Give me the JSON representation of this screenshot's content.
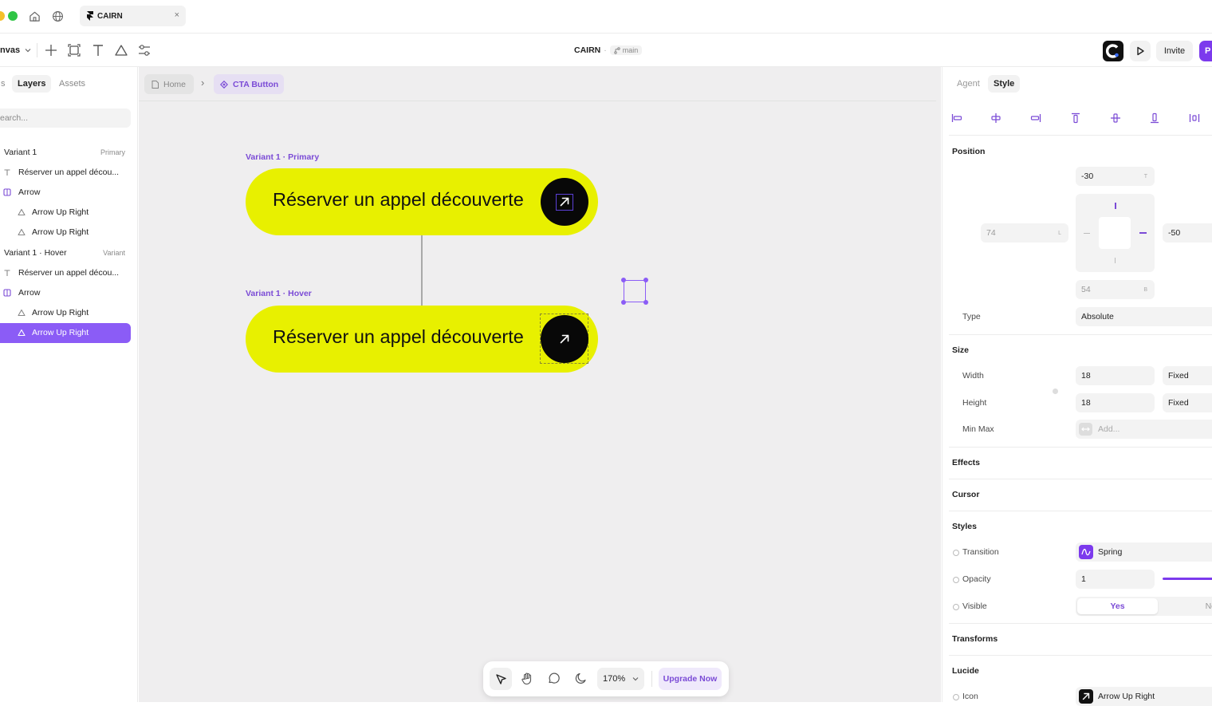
{
  "titlebar": {
    "tab_title": "CAIRN",
    "tab_close": "×"
  },
  "toolbar": {
    "mode_label": "nvas",
    "project_name": "CAIRN",
    "separator": "·",
    "branch": "main",
    "invite_label": "Invite",
    "publish_label": "P"
  },
  "left_panel": {
    "tab_cut": "s",
    "tabs": [
      "Layers",
      "Assets"
    ],
    "search_placeholder": "earch...",
    "layers": [
      {
        "label": "Variant 1",
        "sub": "Primary",
        "kind": "group",
        "selected": false
      },
      {
        "label": "Réserver un appel décou...",
        "kind": "text",
        "selected": false
      },
      {
        "label": "Arrow",
        "kind": "component",
        "selected": false
      },
      {
        "label": "Arrow Up Right",
        "kind": "vector",
        "selected": false
      },
      {
        "label": "Arrow Up Right",
        "kind": "vector",
        "selected": false
      },
      {
        "label": "Variant 1 · Hover",
        "sub": "Variant",
        "kind": "group",
        "selected": false
      },
      {
        "label": "Réserver un appel décou...",
        "kind": "text",
        "selected": false
      },
      {
        "label": "Arrow",
        "kind": "component",
        "selected": false
      },
      {
        "label": "Arrow Up Right",
        "kind": "vector",
        "selected": false
      },
      {
        "label": "Arrow Up Right",
        "kind": "vector",
        "selected": true
      }
    ]
  },
  "canvas": {
    "breadcrumbs": [
      "Home",
      "CTA Button"
    ],
    "breadcrumb_sep": "›",
    "variant_primary_label": "Variant 1 · Primary",
    "variant_hover_label": "Variant 1 · Hover",
    "cta_text": "Réserver un appel découverte"
  },
  "bottom_bar": {
    "zoom": "170%",
    "upgrade_label": "Upgrade Now"
  },
  "right_panel": {
    "tabs": [
      "Agent",
      "Style"
    ],
    "position": {
      "title": "Position",
      "top": "-30",
      "top_unit": "T",
      "left": "74",
      "left_unit": "L",
      "right": "-50",
      "bottom": "54",
      "bottom_unit": "B",
      "type_label": "Type",
      "type_value": "Absolute"
    },
    "size": {
      "title": "Size",
      "width_label": "Width",
      "width_value": "18",
      "width_mode": "Fixed",
      "height_label": "Height",
      "height_value": "18",
      "height_mode": "Fixed",
      "minmax_label": "Min Max",
      "minmax_placeholder": "Add..."
    },
    "effects_title": "Effects",
    "cursor_title": "Cursor",
    "styles": {
      "title": "Styles",
      "transition_label": "Transition",
      "transition_value": "Spring",
      "opacity_label": "Opacity",
      "opacity_value": "1",
      "visible_label": "Visible",
      "visible_yes": "Yes",
      "visible_no": "No"
    },
    "transforms_title": "Transforms",
    "lucide": {
      "title": "Lucide",
      "icon_label": "Icon",
      "icon_value": "Arrow Up Right"
    }
  },
  "colors": {
    "accent": "#7b4bd6",
    "cta_yellow": "#e8f000",
    "selection": "#8b5cf6"
  }
}
